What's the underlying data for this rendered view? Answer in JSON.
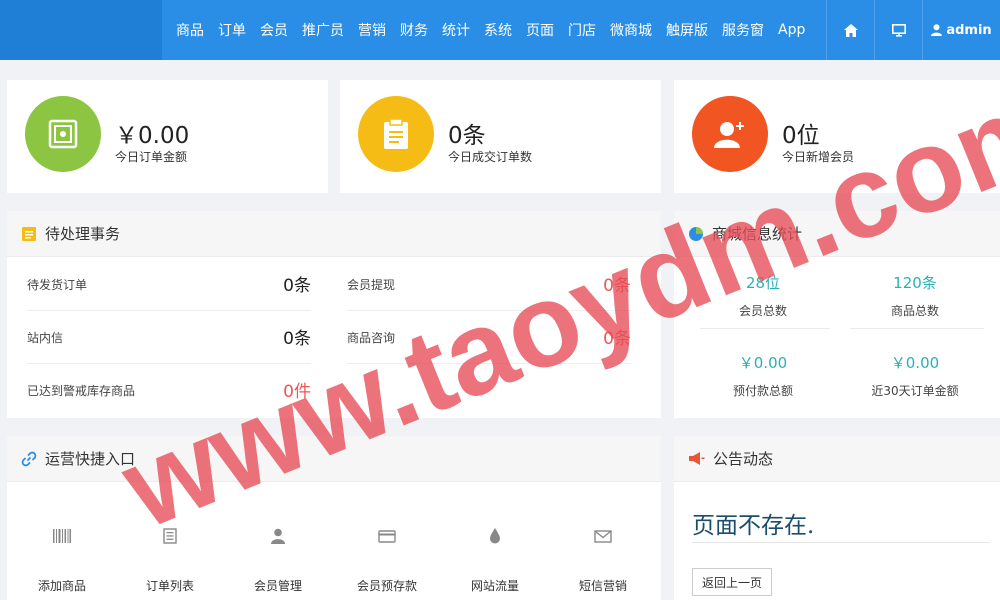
{
  "nav": {
    "items": [
      "商品",
      "订单",
      "会员",
      "推广员",
      "营销",
      "财务",
      "统计",
      "系统",
      "页面",
      "门店",
      "微商城",
      "触屏版",
      "服务窗",
      "App"
    ],
    "user": "admin"
  },
  "stats": [
    {
      "value": "￥0.00",
      "label": "今日订单金额",
      "color": "#8cc541",
      "icon": "safe-icon"
    },
    {
      "value": "0条",
      "label": "今日成交订单数",
      "color": "#f6bc16",
      "icon": "clipboard-icon"
    },
    {
      "value": "0位",
      "label": "今日新增会员",
      "color": "#f05522",
      "icon": "user-add-icon"
    }
  ],
  "pending": {
    "title": "待处理事务",
    "items": [
      {
        "label": "待发货订单",
        "value": "0条"
      },
      {
        "label": "会员提现",
        "value": "0条"
      },
      {
        "label": "站内信",
        "value": "0条"
      },
      {
        "label": "商品咨询",
        "value": "0条"
      },
      {
        "label": "已达到警戒库存商品",
        "value": "0件"
      }
    ]
  },
  "mall_stats": {
    "title": "商城信息统计",
    "items": [
      {
        "value": "28位",
        "label": "会员总数"
      },
      {
        "value": "120条",
        "label": "商品总数"
      },
      {
        "value": "￥0.00",
        "label": "预付款总额"
      },
      {
        "value": "￥0.00",
        "label": "近30天订单金额"
      }
    ]
  },
  "quick": {
    "title": "运营快捷入口",
    "items": [
      "添加商品",
      "订单列表",
      "会员管理",
      "会员预存款",
      "网站流量",
      "短信营销"
    ]
  },
  "notice": {
    "title": "公告动态",
    "message": "页面不存在.",
    "back": "返回上一页"
  },
  "watermark": "www.taoydm.com"
}
